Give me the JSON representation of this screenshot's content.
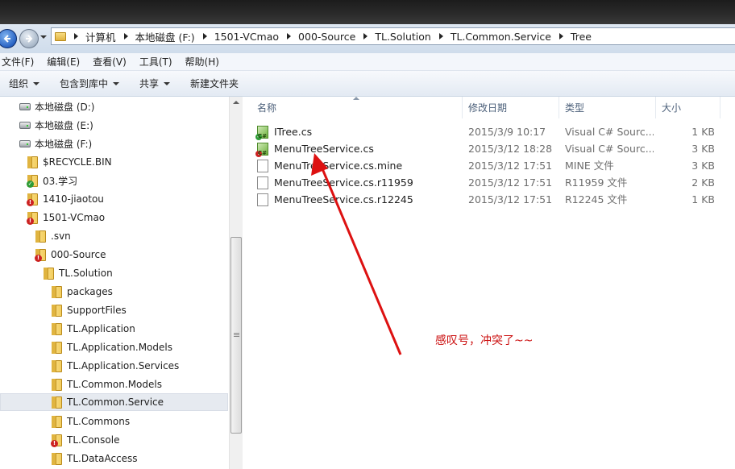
{
  "address_bar": {
    "crumbs": [
      "计算机",
      "本地磁盘 (F:)",
      "1501-VCmao",
      "000-Source",
      "TL.Solution",
      "TL.Common.Service",
      "Tree"
    ]
  },
  "menu": [
    "文件(F)",
    "编辑(E)",
    "查看(V)",
    "工具(T)",
    "帮助(H)"
  ],
  "toolbar": {
    "organize": "组织",
    "include_in_library": "包含到库中",
    "share": "共享",
    "new_folder": "新建文件夹"
  },
  "nav_tree": [
    {
      "label": "本地磁盘 (D:)",
      "icon": "drive-icon"
    },
    {
      "label": "本地磁盘 (E:)",
      "icon": "drive-icon"
    },
    {
      "label": "本地磁盘 (F:)",
      "icon": "drive-icon"
    },
    {
      "label": "$RECYCLE.BIN",
      "icon": "folder-icon"
    },
    {
      "label": "03.学习",
      "icon": "folder-ok-icon"
    },
    {
      "label": "1410-jiaotou",
      "icon": "folder-conflict-icon"
    },
    {
      "label": "1501-VCmao",
      "icon": "folder-conflict-icon"
    },
    {
      "label": ".svn",
      "icon": "folder-icon"
    },
    {
      "label": "000-Source",
      "icon": "folder-conflict-icon"
    },
    {
      "label": "TL.Solution",
      "icon": "folder-icon"
    },
    {
      "label": "packages",
      "icon": "folder-icon"
    },
    {
      "label": "SupportFiles",
      "icon": "folder-icon"
    },
    {
      "label": "TL.Application",
      "icon": "folder-icon"
    },
    {
      "label": "TL.Application.Models",
      "icon": "folder-icon"
    },
    {
      "label": "TL.Application.Services",
      "icon": "folder-icon"
    },
    {
      "label": "TL.Common.Models",
      "icon": "folder-icon"
    },
    {
      "label": "TL.Common.Service",
      "icon": "folder-icon",
      "selected": true
    },
    {
      "label": "TL.Commons",
      "icon": "folder-icon"
    },
    {
      "label": "TL.Console",
      "icon": "folder-conflict-icon"
    },
    {
      "label": "TL.DataAccess",
      "icon": "folder-icon"
    }
  ],
  "columns": {
    "name": "名称",
    "date": "修改日期",
    "type": "类型",
    "size": "大小"
  },
  "files": [
    {
      "name": "ITree.cs",
      "date": "2015/3/9 10:17",
      "type": "Visual C# Sourc...",
      "size": "1 KB",
      "icon": "cs-file-ok-icon"
    },
    {
      "name": "MenuTreeService.cs",
      "date": "2015/3/12 18:28",
      "type": "Visual C# Sourc...",
      "size": "3 KB",
      "icon": "cs-file-conflict-icon"
    },
    {
      "name": "MenuTreeService.cs.mine",
      "date": "2015/3/12 17:51",
      "type": "MINE 文件",
      "size": "3 KB",
      "icon": "file-icon"
    },
    {
      "name": "MenuTreeService.cs.r11959",
      "date": "2015/3/12 17:51",
      "type": "R11959 文件",
      "size": "2 KB",
      "icon": "file-icon"
    },
    {
      "name": "MenuTreeService.cs.r12245",
      "date": "2015/3/12 17:51",
      "type": "R12245 文件",
      "size": "1 KB",
      "icon": "file-icon"
    }
  ],
  "annotation": "感叹号，冲突了~~",
  "colors": {
    "annotation": "#cc1111",
    "selection": "#e6eaf0"
  }
}
